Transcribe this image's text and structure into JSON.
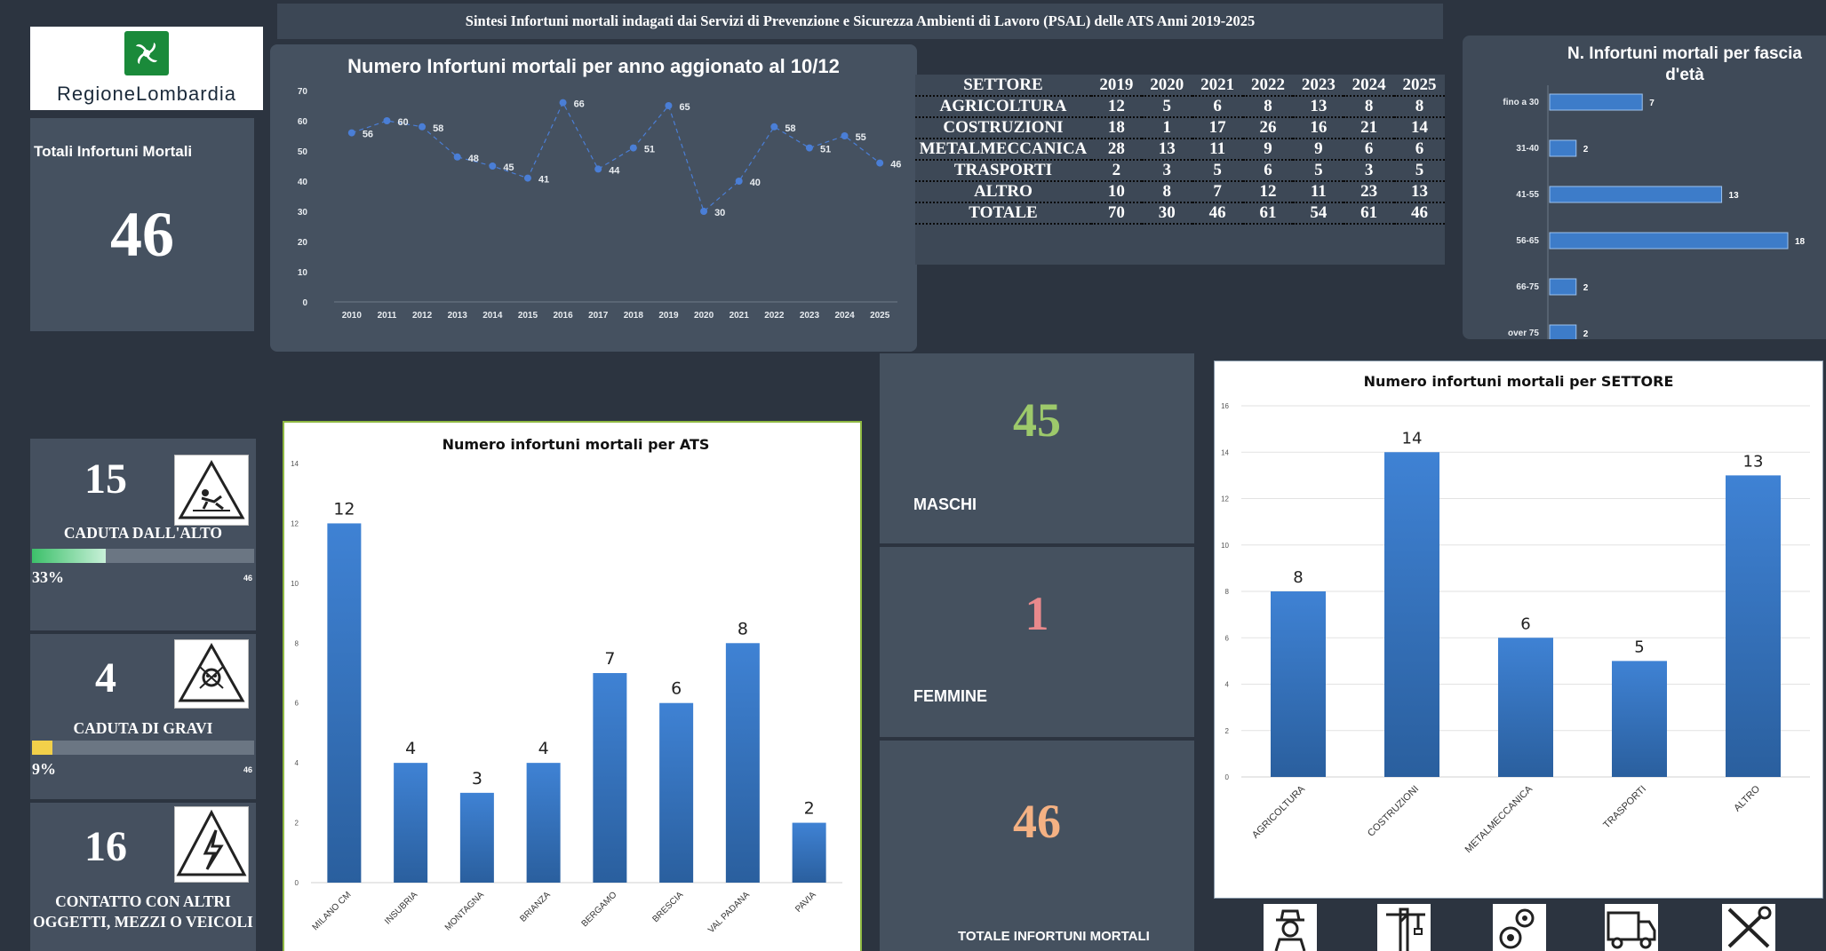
{
  "title": "Sintesi Infortuni mortali indagati dai Servizi di Prevenzione e Sicurezza Ambienti di Lavoro (PSAL) delle ATS Anni 2019-2025",
  "logo": {
    "name": "RegioneLombardia",
    "icon": "lombardy-rose-icon",
    "color": "#1a8a3a"
  },
  "totals": {
    "label": "Totali Infortuni Mortali",
    "value": "46"
  },
  "colors": {
    "bar_blue": "#3d7cc9",
    "male_green": "#9dc96b",
    "female_red": "#e9898c",
    "total_orange": "#f4b183",
    "line_blue": "#4a7ed6",
    "panel": "#455160",
    "background": "#2c3440"
  },
  "sector_table": {
    "header": [
      "SETTORE",
      "2019",
      "2020",
      "2021",
      "2022",
      "2023",
      "2024",
      "2025"
    ],
    "rows": [
      [
        "AGRICOLTURA",
        "12",
        "5",
        "6",
        "8",
        "13",
        "8",
        "8"
      ],
      [
        "COSTRUZIONI",
        "18",
        "1",
        "17",
        "26",
        "16",
        "21",
        "14"
      ],
      [
        "METALMECCANICA",
        "28",
        "13",
        "11",
        "9",
        "9",
        "6",
        "6"
      ],
      [
        "TRASPORTI",
        "2",
        "3",
        "5",
        "6",
        "5",
        "3",
        "5"
      ],
      [
        "ALTRO",
        "10",
        "8",
        "7",
        "12",
        "11",
        "23",
        "13"
      ],
      [
        "TOTALE",
        "70",
        "30",
        "46",
        "61",
        "54",
        "61",
        "46"
      ]
    ]
  },
  "accidents": [
    {
      "value": "15",
      "label": "CADUTA DALL'ALTO",
      "percent_text": "33%",
      "percent": 0.33,
      "total": "46",
      "icon": "fall-from-height-warning-icon",
      "bar_color": "#3cc06a"
    },
    {
      "value": "4",
      "label": "CADUTA DI GRAVI",
      "percent_text": "9%",
      "percent": 0.09,
      "total": "46",
      "icon": "falling-objects-warning-icon",
      "bar_color": "#f2d04a"
    },
    {
      "value": "16",
      "label": "CONTATTO CON ALTRI OGGETTI, MEZZI O VEICOLI",
      "icon": "electric-hazard-warning-icon"
    }
  ],
  "gender": {
    "male": {
      "value": "45",
      "label": "MASCHI"
    },
    "female": {
      "value": "1",
      "label": "FEMMINE"
    },
    "total": {
      "value": "46",
      "label": "TOTALE INFORTUNI MORTALI"
    }
  },
  "sector_icons": [
    "farmer-icon",
    "construction-crane-icon",
    "gears-icon",
    "truck-icon",
    "tools-icon"
  ],
  "chart_data": [
    {
      "type": "line",
      "title": "Numero Infortuni mortali per anno aggionato al  10/12",
      "x": [
        "2010",
        "2011",
        "2012",
        "2013",
        "2014",
        "2015",
        "2016",
        "2017",
        "2018",
        "2019",
        "2020",
        "2021",
        "2022",
        "2023",
        "2024",
        "2025"
      ],
      "values": [
        56,
        60,
        58,
        48,
        45,
        41,
        66,
        44,
        51,
        65,
        30,
        40,
        58,
        51,
        55,
        46
      ],
      "ylim": [
        0,
        70
      ],
      "yticks": [
        0,
        10,
        20,
        30,
        40,
        50,
        60,
        70
      ]
    },
    {
      "type": "bar",
      "orientation": "horizontal",
      "title": "N. Infortuni mortali per fascia d'età",
      "categories": [
        "fino a 30",
        "31-40",
        "41-55",
        "56-65",
        "66-75",
        "over 75"
      ],
      "values": [
        7,
        2,
        13,
        18,
        2,
        2
      ]
    },
    {
      "type": "bar",
      "title": "Numero infortuni mortali per ATS",
      "categories": [
        "MILANO CM",
        "INSUBRIA",
        "MONTAGNA",
        "BRIANZA",
        "BERGAMO",
        "BRESCIA",
        "VAL PADANA",
        "PAVIA"
      ],
      "values": [
        12,
        4,
        3,
        4,
        7,
        6,
        8,
        2
      ],
      "ylim": [
        0,
        14
      ],
      "yticks": [
        0,
        2,
        4,
        6,
        8,
        10,
        12,
        14
      ]
    },
    {
      "type": "bar",
      "title": "Numero infortuni mortali per SETTORE",
      "categories": [
        "AGRICOLTURA",
        "COSTRUZIONI",
        "METALMECCANICA",
        "TRASPORTI",
        "ALTRO"
      ],
      "values": [
        8,
        14,
        6,
        5,
        13
      ],
      "ylim": [
        0,
        16
      ],
      "yticks": [
        0,
        2,
        4,
        6,
        8,
        10,
        12,
        14,
        16
      ]
    }
  ]
}
